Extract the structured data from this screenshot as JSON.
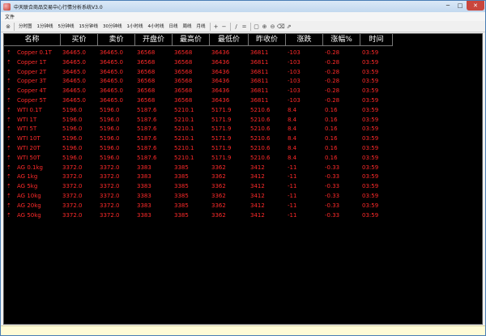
{
  "window": {
    "title": "中天联合商品交易中心行情分析系统V3.0",
    "controls": {
      "minimize": "─",
      "maximize": "□",
      "close": "✕"
    }
  },
  "menu": {
    "items": [
      "文件"
    ]
  },
  "toolbar": {
    "period_buttons": [
      "分时图",
      "1分钟线",
      "5分钟线",
      "15分钟线",
      "30分钟线",
      "1小时线",
      "4小时线",
      "日线",
      "周线",
      "月线"
    ],
    "tools": [
      {
        "name": "close-icon",
        "glyph": "⊗"
      },
      {
        "name": "zoom-in-icon",
        "glyph": "+"
      },
      {
        "name": "zoom-out-icon",
        "glyph": "−"
      },
      {
        "name": "line-tool-icon",
        "glyph": "/"
      },
      {
        "name": "dash-tool-icon",
        "glyph": "="
      },
      {
        "name": "window-icon",
        "glyph": "▢"
      },
      {
        "name": "magnify-plus-icon",
        "glyph": "⊕"
      },
      {
        "name": "magnify-minus-icon",
        "glyph": "⊖"
      },
      {
        "name": "delete-icon",
        "glyph": "⌫"
      },
      {
        "name": "export-icon",
        "glyph": "⇗"
      }
    ]
  },
  "table": {
    "columns": [
      "名称",
      "买价",
      "卖价",
      "开盘价",
      "最高价",
      "最低价",
      "昨收价",
      "涨跌",
      "涨幅%",
      "时间"
    ],
    "rows": [
      [
        "Copper 0.1T",
        "36465.0",
        "36465.0",
        "36568",
        "36568",
        "36436",
        "36811",
        "-103",
        "-0.28",
        "03:59"
      ],
      [
        "Copper 1T",
        "36465.0",
        "36465.0",
        "36568",
        "36568",
        "36436",
        "36811",
        "-103",
        "-0.28",
        "03:59"
      ],
      [
        "Copper 2T",
        "36465.0",
        "36465.0",
        "36568",
        "36568",
        "36436",
        "36811",
        "-103",
        "-0.28",
        "03:59"
      ],
      [
        "Copper 3T",
        "36465.0",
        "36465.0",
        "36568",
        "36568",
        "36436",
        "36811",
        "-103",
        "-0.28",
        "03:59"
      ],
      [
        "Copper 4T",
        "36465.0",
        "36465.0",
        "36568",
        "36568",
        "36436",
        "36811",
        "-103",
        "-0.28",
        "03:59"
      ],
      [
        "Copper 5T",
        "36465.0",
        "36465.0",
        "36568",
        "36568",
        "36436",
        "36811",
        "-103",
        "-0.28",
        "03:59"
      ],
      [
        "WTI 0.1T",
        "5196.0",
        "5196.0",
        "5187.6",
        "5210.1",
        "5171.9",
        "5210.6",
        "8.4",
        "0.16",
        "03:59"
      ],
      [
        "WTI 1T",
        "5196.0",
        "5196.0",
        "5187.6",
        "5210.1",
        "5171.9",
        "5210.6",
        "8.4",
        "0.16",
        "03:59"
      ],
      [
        "WTI 5T",
        "5196.0",
        "5196.0",
        "5187.6",
        "5210.1",
        "5171.9",
        "5210.6",
        "8.4",
        "0.16",
        "03:59"
      ],
      [
        "WTI 10T",
        "5196.0",
        "5196.0",
        "5187.6",
        "5210.1",
        "5171.9",
        "5210.6",
        "8.4",
        "0.16",
        "03:59"
      ],
      [
        "WTI 20T",
        "5196.0",
        "5196.0",
        "5187.6",
        "5210.1",
        "5171.9",
        "5210.6",
        "8.4",
        "0.16",
        "03:59"
      ],
      [
        "WTI 50T",
        "5196.0",
        "5196.0",
        "5187.6",
        "5210.1",
        "5171.9",
        "5210.6",
        "8.4",
        "0.16",
        "03:59"
      ],
      [
        "AG 0.1kg",
        "3372.0",
        "3372.0",
        "3383",
        "3385",
        "3362",
        "3412",
        "-11",
        "-0.33",
        "03:59"
      ],
      [
        "AG 1kg",
        "3372.0",
        "3372.0",
        "3383",
        "3385",
        "3362",
        "3412",
        "-11",
        "-0.33",
        "03:59"
      ],
      [
        "AG 5kg",
        "3372.0",
        "3372.0",
        "3383",
        "3385",
        "3362",
        "3412",
        "-11",
        "-0.33",
        "03:59"
      ],
      [
        "AG 10kg",
        "3372.0",
        "3372.0",
        "3383",
        "3385",
        "3362",
        "3412",
        "-11",
        "-0.33",
        "03:59"
      ],
      [
        "AG 20kg",
        "3372.0",
        "3372.0",
        "3383",
        "3385",
        "3362",
        "3412",
        "-11",
        "-0.33",
        "03:59"
      ],
      [
        "AG 50kg",
        "3372.0",
        "3372.0",
        "3383",
        "3385",
        "3362",
        "3412",
        "-11",
        "-0.33",
        "03:59"
      ]
    ],
    "row_arrow": "⇡",
    "colors": {
      "background": "#000000",
      "header_text": "#ffffff",
      "price_text": "#ff2a2a"
    }
  }
}
